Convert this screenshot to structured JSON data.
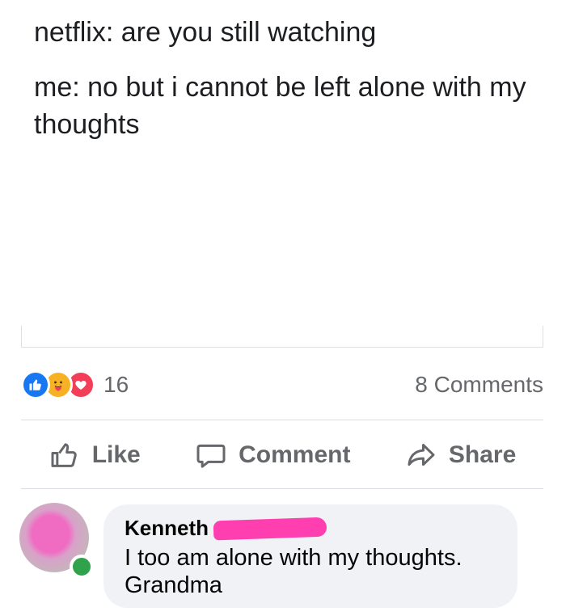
{
  "post": {
    "line1": "netflix: are you still watching",
    "line2": "me: no but i cannot be left alone with my thoughts"
  },
  "stats": {
    "reactions": [
      "like",
      "care",
      "love"
    ],
    "reaction_count": "16",
    "comment_count": "8 Comments"
  },
  "actions": {
    "like": "Like",
    "comment": "Comment",
    "share": "Share"
  },
  "comment": {
    "author": "Kenneth",
    "author_redacted": true,
    "text": "I too am alone with my thoughts. Grandma",
    "online": true
  },
  "colors": {
    "like_blue": "#1877f2",
    "love_red": "#f33e58",
    "care_yellow": "#f7b125",
    "online_green": "#31a24c",
    "redaction_pink": "#ff3fb0",
    "bubble_bg": "#f0f2f5"
  }
}
